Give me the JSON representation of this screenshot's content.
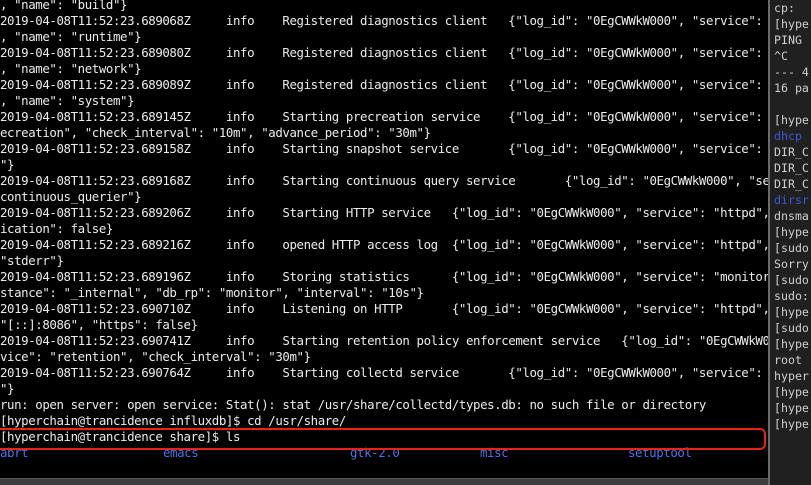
{
  "terminal": {
    "log_lines": [
      ", \"name\": \"build\"}",
      "2019-04-08T11:52:23.689068Z     info    Registered diagnostics client   {\"log_id\": \"0EgCWWkW000\", \"service\": \"monitor\"",
      ", \"name\": \"runtime\"}",
      "2019-04-08T11:52:23.689080Z     info    Registered diagnostics client   {\"log_id\": \"0EgCWWkW000\", \"service\": \"monitor\"",
      ", \"name\": \"network\"}",
      "2019-04-08T11:52:23.689089Z     info    Registered diagnostics client   {\"log_id\": \"0EgCWWkW000\", \"service\": \"monitor\"",
      ", \"name\": \"system\"}",
      "2019-04-08T11:52:23.689145Z     info    Starting precreation service    {\"log_id\": \"0EgCWWkW000\", \"service\": \"shard-pr",
      "ecreation\", \"check_interval\": \"10m\", \"advance_period\": \"30m\"}",
      "2019-04-08T11:52:23.689158Z     info    Starting snapshot service       {\"log_id\": \"0EgCWWkW000\", \"service\": \"snapshot",
      "\"}",
      "2019-04-08T11:52:23.689168Z     info    Starting continuous query service       {\"log_id\": \"0EgCWWkW000\", \"service\": \"",
      "continuous_querier\"}",
      "2019-04-08T11:52:23.689206Z     info    Starting HTTP service   {\"log_id\": \"0EgCWWkW000\", \"service\": \"httpd\", \"authent",
      "ication\": false}",
      "2019-04-08T11:52:23.689216Z     info    opened HTTP access log  {\"log_id\": \"0EgCWWkW000\", \"service\": \"httpd\", \"path\":",
      "\"stderr\"}",
      "2019-04-08T11:52:23.689196Z     info    Storing statistics      {\"log_id\": \"0EgCWWkW000\", \"service\": \"monitor\", \"db_in",
      "stance\": \"_internal\", \"db_rp\": \"monitor\", \"interval\": \"10s\"}",
      "2019-04-08T11:52:23.690710Z     info    Listening on HTTP       {\"log_id\": \"0EgCWWkW000\", \"service\": \"httpd\", \"addr\":",
      "\"[::]:8086\", \"https\": false}",
      "2019-04-08T11:52:23.690741Z     info    Starting retention policy enforcement service   {\"log_id\": \"0EgCWWkW000\", \"ser",
      "vice\": \"retention\", \"check_interval\": \"30m\"}",
      "2019-04-08T11:52:23.690764Z     info    Starting collectd service       {\"log_id\": \"0EgCWWkW000\", \"service\": \"collectd",
      "\"}"
    ],
    "error_line": "run: open server: open service: Stat(): stat /usr/share/collectd/types.db: no such file or directory",
    "prompt_cd": "[hyperchain@trancidence influxdb]$ cd /usr/share/",
    "prompt_ls": "[hyperchain@trancidence share]$ ls",
    "ls_entries": [
      "abrt",
      "emacs",
      "gtk-2.0",
      "misc",
      "setuptool"
    ],
    "ls_color": "#4a73e8",
    "highlight_color": "#e8231a"
  },
  "side_terminal": {
    "lines": [
      {
        "text": "cp: ",
        "color": "normal"
      },
      {
        "text": "[hype",
        "color": "normal"
      },
      {
        "text": "PING ",
        "color": "normal"
      },
      {
        "text": "^C",
        "color": "normal"
      },
      {
        "text": "--- 4",
        "color": "normal"
      },
      {
        "text": "16 pa",
        "color": "normal"
      },
      {
        "text": "",
        "color": "normal"
      },
      {
        "text": "[hype",
        "color": "normal"
      },
      {
        "text": "dhcp",
        "color": "blue"
      },
      {
        "text": "DIR_C",
        "color": "normal"
      },
      {
        "text": "DIR_C",
        "color": "normal"
      },
      {
        "text": "DIR_C",
        "color": "normal"
      },
      {
        "text": "dirsr",
        "color": "blue"
      },
      {
        "text": "dnsma",
        "color": "normal"
      },
      {
        "text": "[hype",
        "color": "normal"
      },
      {
        "text": "[sudo",
        "color": "normal"
      },
      {
        "text": "Sorry",
        "color": "normal"
      },
      {
        "text": "[sudo",
        "color": "normal"
      },
      {
        "text": "sudo:",
        "color": "normal"
      },
      {
        "text": "[hype",
        "color": "normal"
      },
      {
        "text": "[sudo",
        "color": "normal"
      },
      {
        "text": "[hype",
        "color": "normal"
      },
      {
        "text": "root ",
        "color": "normal"
      },
      {
        "text": "hyper",
        "color": "normal"
      },
      {
        "text": "[hype",
        "color": "normal"
      },
      {
        "text": "[hype",
        "color": "normal"
      },
      {
        "text": "[hype",
        "color": "normal"
      }
    ]
  }
}
